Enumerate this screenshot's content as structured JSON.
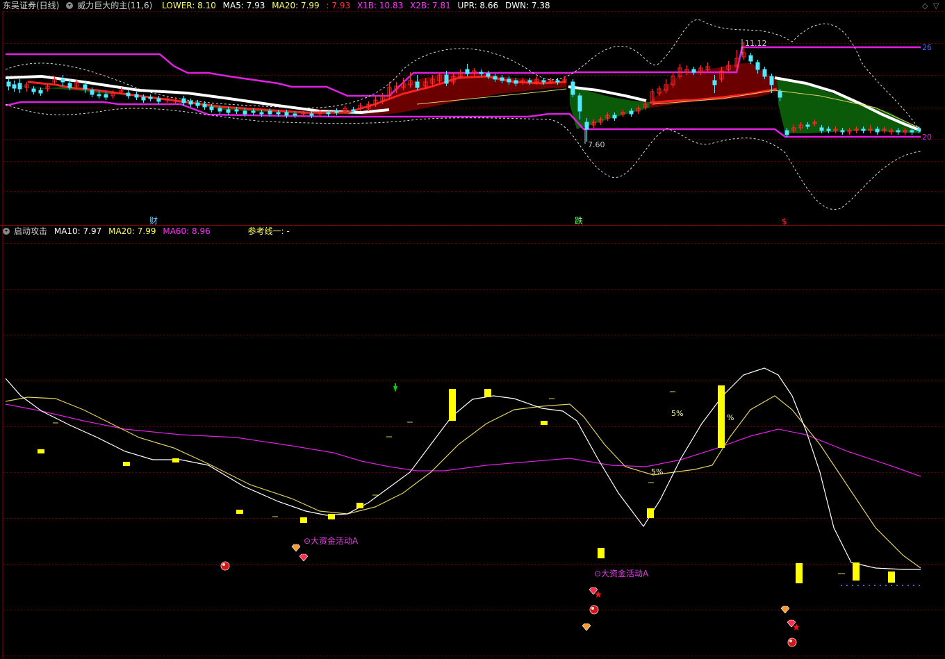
{
  "top_panel": {
    "title": "东吴证券(日线)",
    "indicator": "威力巨大的主",
    "params": "(11,6)",
    "values": [
      {
        "label": "LOWER: 8.10",
        "color": "#ffff66"
      },
      {
        "label": "MA5: 7.93",
        "color": "#ffffff"
      },
      {
        "label": "MA20: 7.99",
        "color": "#ffff66"
      },
      {
        "label": ": 7.93",
        "color": "#ff3333"
      },
      {
        "label": "X1B: 10.83",
        "color": "#ff33ff"
      },
      {
        "label": "X2B: 7.81",
        "color": "#ff33ff"
      },
      {
        "label": "UPR: 8.66",
        "color": "#ffffff"
      },
      {
        "label": "DWN: 7.38",
        "color": "#ffffff"
      }
    ],
    "high_label": "11.12",
    "low_label": "7.60",
    "right_label_top": "26",
    "right_label_bottom": "20",
    "markers": [
      {
        "text": "财",
        "color": "#66ccff"
      },
      {
        "text": "跌",
        "color": "#66ff66"
      },
      {
        "text": "$",
        "color": "#ff3333"
      }
    ]
  },
  "bottom_panel": {
    "indicator": "启动攻击",
    "values": [
      {
        "label": "MA10: 7.97",
        "color": "#ffffff"
      },
      {
        "label": "MA20: 7.99",
        "color": "#ffff66"
      },
      {
        "label": "MA60: 8.96",
        "color": "#ff33ff"
      }
    ],
    "ref_line": "参考线一: -",
    "annotations": [
      "⊙大资金活动A",
      "⊙大资金活动A"
    ],
    "pct_labels": [
      "5%",
      "%",
      "5%"
    ]
  },
  "controls": [
    "◇",
    "▽"
  ],
  "colors": {
    "accent_red": "#ff2020",
    "magenta": "#e020e0",
    "yellow": "#ffff00",
    "green": "#006400",
    "grid": "#8b0000"
  }
}
